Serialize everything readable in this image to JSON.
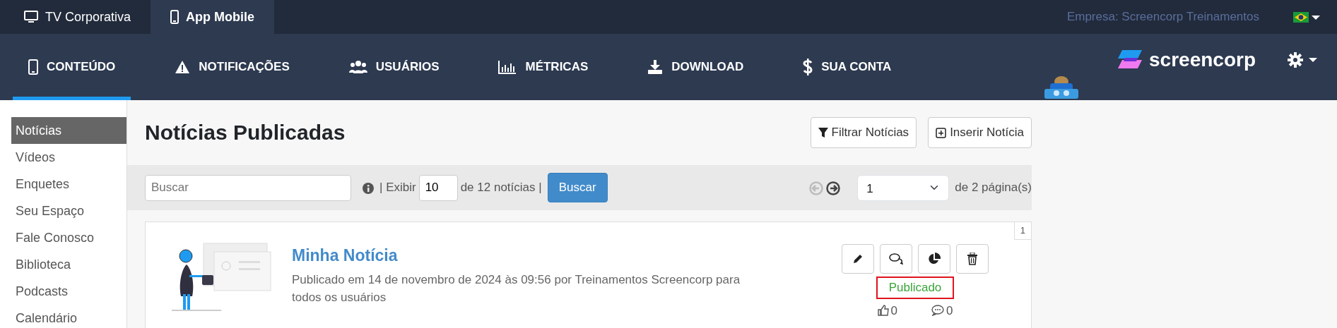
{
  "top_tabs": [
    {
      "label": "TV Corporativa",
      "selected": false
    },
    {
      "label": "App Mobile",
      "selected": true
    }
  ],
  "company": "Empresa: Screencorp Treinamentos",
  "nav": [
    {
      "label": "CONTEÚDO",
      "selected": true
    },
    {
      "label": "NOTIFICAÇÕES",
      "selected": false
    },
    {
      "label": "USUÁRIOS",
      "selected": false
    },
    {
      "label": "MÉTRICAS",
      "selected": false
    },
    {
      "label": "DOWNLOAD",
      "selected": false
    },
    {
      "label": "SUA CONTA",
      "selected": false
    }
  ],
  "logo": "screencorp",
  "sidebar": {
    "items": [
      {
        "label": "Notícias",
        "selected": true
      },
      {
        "label": "Vídeos",
        "selected": false
      },
      {
        "label": "Enquetes",
        "selected": false
      },
      {
        "label": "Seu Espaço",
        "selected": false
      },
      {
        "label": "Fale Conosco",
        "selected": false
      },
      {
        "label": "Biblioteca",
        "selected": false
      },
      {
        "label": "Podcasts",
        "selected": false
      },
      {
        "label": "Calendário",
        "selected": false
      }
    ]
  },
  "page_title": "Notícias Publicadas",
  "header_buttons": [
    "Filtrar Notícias",
    "Inserir Notícia"
  ],
  "toolbar": {
    "search": {
      "placeholder": "Buscar"
    },
    "show_label": "| Exibir",
    "show_value": "10",
    "count_text": "de 12 notícias |",
    "search_button": "Buscar",
    "prev_disabled": true,
    "next_disabled": false,
    "page_value": "1",
    "pages_text": "de 2 página(s)"
  },
  "news": [
    {
      "index": "1",
      "title": "Minha Notícia",
      "description": "Publicado em 14 de novembro de 2024 às 09:56 por Treinamentos Screencorp para todos os usuários",
      "status": "Publicado",
      "highlighted": true,
      "likes": "0",
      "comments": "0"
    }
  ]
}
